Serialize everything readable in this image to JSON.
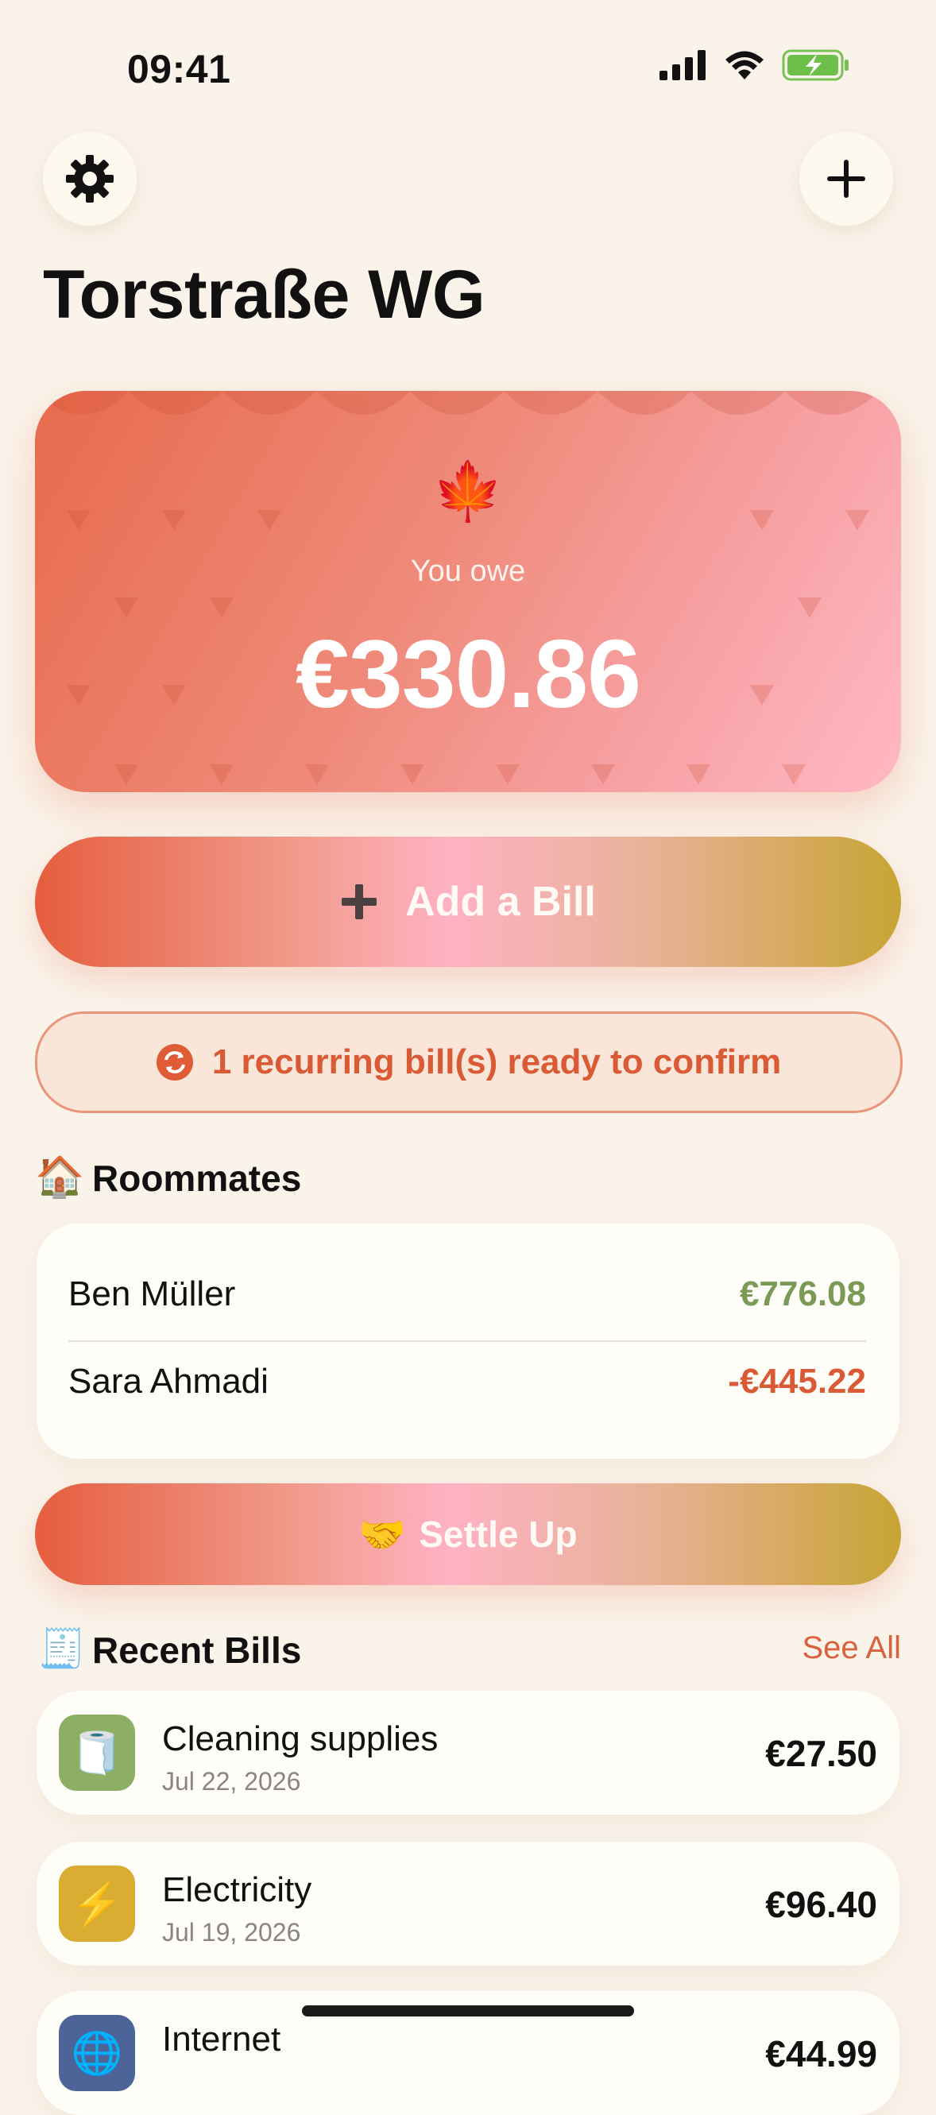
{
  "status_bar": {
    "time": "09:41"
  },
  "header": {
    "title": "Torstraße WG",
    "settings_icon": "gear-icon",
    "add_icon": "plus-icon"
  },
  "balance_card": {
    "emoji": "🍁",
    "label": "You owe",
    "amount": "€330.86"
  },
  "add_bill": {
    "icon": "plus-icon",
    "label": "Add a Bill"
  },
  "recurring": {
    "icon": "recurring-icon",
    "label": "1 recurring bill(s) ready to confirm"
  },
  "roommates": {
    "emoji": "🏠",
    "title": "Roommates",
    "items": [
      {
        "name": "Ben Müller",
        "amount": "€776.08",
        "color": "#7a9a55"
      },
      {
        "name": "Sara Ahmadi",
        "amount": "-€445.22",
        "color": "#d95a34"
      }
    ]
  },
  "settle_up": {
    "emoji": "🤝",
    "label": "Settle Up"
  },
  "recent_bills": {
    "emoji": "🧾",
    "title": "Recent Bills",
    "see_all": "See All",
    "items": [
      {
        "title": "Cleaning supplies",
        "date": "Jul 22, 2026",
        "amount": "€27.50",
        "icon": "🧻",
        "icon_color": "#8caf63"
      },
      {
        "title": "Electricity",
        "date": "Jul 19, 2026",
        "amount": "€96.40",
        "icon": "⚡",
        "icon_color": "#d8ad32"
      },
      {
        "title": "Internet",
        "date": "",
        "amount": "€44.99",
        "icon": "🌐",
        "icon_color": "#4c6497"
      }
    ]
  },
  "colors": {
    "background": "#faf3ea",
    "accent": "#d95a34",
    "positive": "#7a9a55",
    "negative": "#d95a34"
  }
}
